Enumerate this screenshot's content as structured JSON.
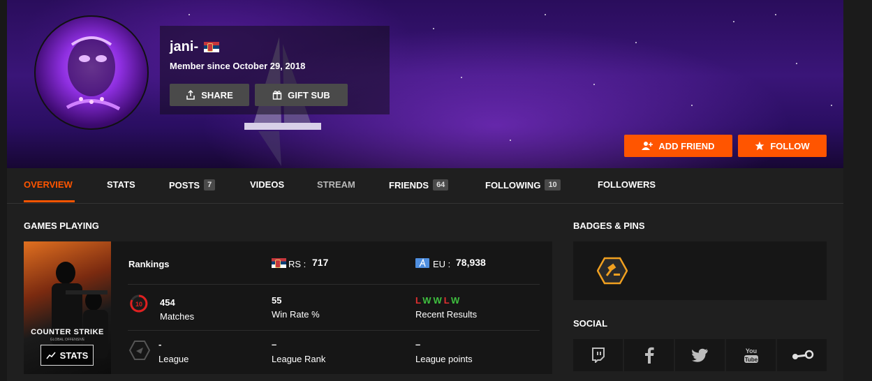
{
  "profile": {
    "username": "jani-",
    "member_since": "Member since October 29, 2018",
    "share_label": "SHARE",
    "gift_sub_label": "GIFT SUB",
    "add_friend_label": "ADD FRIEND",
    "follow_label": "FOLLOW"
  },
  "nav": {
    "tabs": [
      {
        "label": "OVERVIEW"
      },
      {
        "label": "STATS"
      },
      {
        "label": "POSTS",
        "count": "7"
      },
      {
        "label": "VIDEOS"
      },
      {
        "label": "STREAM"
      },
      {
        "label": "FRIENDS",
        "count": "64"
      },
      {
        "label": "FOLLOWING",
        "count": "10"
      },
      {
        "label": "FOLLOWERS"
      }
    ]
  },
  "games": {
    "title": "GAMES PLAYING",
    "game_name": "COUNTER STRIKE",
    "game_subtitle": "GLOBAL OFFENSIVE",
    "stats_button": "STATS",
    "rankings_label": "Rankings",
    "rs_label": "RS :",
    "rs_value": "717",
    "eu_label": "EU :",
    "eu_value": "78,938",
    "level": "10",
    "matches_value": "454",
    "matches_label": "Matches",
    "winrate_value": "55",
    "winrate_label": "Win Rate %",
    "recent_results": [
      "L",
      "W",
      "W",
      "L",
      "W"
    ],
    "recent_label": "Recent Results",
    "league_value": "-",
    "league_label": "League",
    "league_rank_value": "–",
    "league_rank_label": "League Rank",
    "league_points_value": "–",
    "league_points_label": "League points"
  },
  "badges": {
    "title": "BADGES & PINS"
  },
  "social": {
    "title": "SOCIAL",
    "icons": [
      "twitch-icon",
      "facebook-icon",
      "twitter-icon",
      "youtube-icon",
      "steam-icon"
    ]
  },
  "colors": {
    "accent": "#ff5500",
    "win": "#3fbf3f",
    "loss": "#e03030",
    "badge": "#f0a020"
  }
}
